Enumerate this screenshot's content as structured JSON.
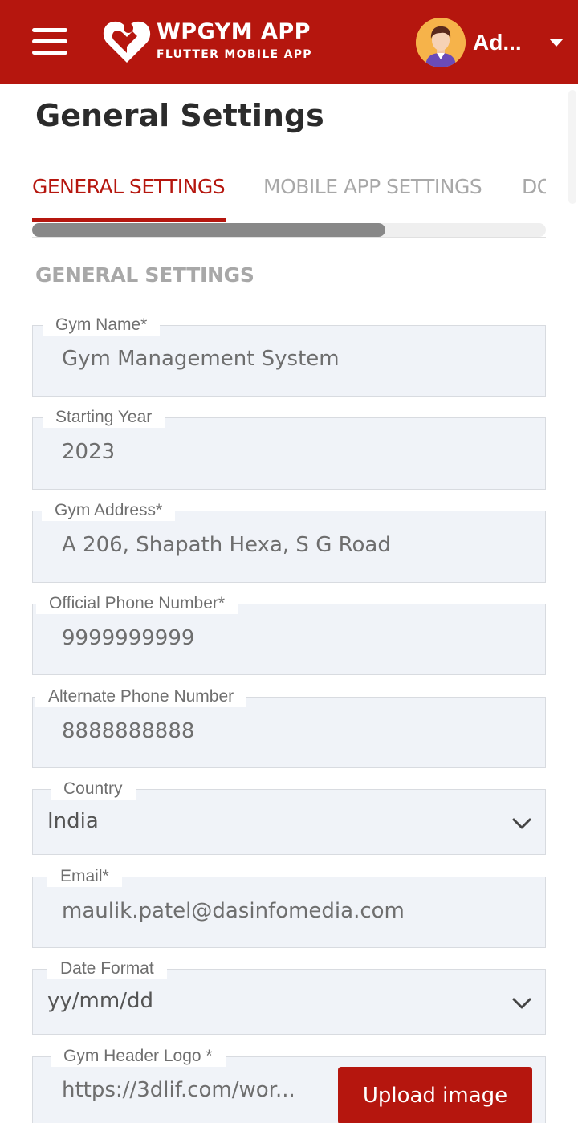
{
  "appbar": {
    "brand_title": "WPGYM APP",
    "brand_subtitle": "FLUTTER MOBILE APP",
    "user_name": "Ad...",
    "bg_color": "#b5160e",
    "menu_icon": "hamburger-icon",
    "dropdown_icon": "caret-down-icon"
  },
  "page": {
    "title": "General Settings"
  },
  "tabs": [
    {
      "label": "GENERAL SETTINGS",
      "active": true
    },
    {
      "label": "MOBILE APP SETTINGS",
      "active": false
    },
    {
      "label": "DOCUMENT SETTINGS",
      "active": false
    }
  ],
  "section": {
    "title": "GENERAL SETTINGS"
  },
  "fields": {
    "gym_name": {
      "label": "Gym Name*",
      "value": "Gym Management System"
    },
    "starting_year": {
      "label": "Starting Year",
      "value": "2023"
    },
    "gym_address": {
      "label": "Gym Address*",
      "value": "A 206, Shapath Hexa, S G Road"
    },
    "official_phone": {
      "label": "Official Phone Number*",
      "value": "9999999999"
    },
    "alternate_phone": {
      "label": "Alternate Phone Number",
      "value": "8888888888"
    },
    "country": {
      "label": "Country",
      "value": "India"
    },
    "email": {
      "label": "Email*",
      "value": "maulik.patel@dasinfomedia.com"
    },
    "date_format": {
      "label": "Date Format",
      "value": "yy/mm/dd"
    },
    "gym_header_logo": {
      "label": "Gym Header Logo *",
      "value": "https://3dlif.com/wor...",
      "button_label": "Upload image"
    }
  },
  "colors": {
    "accent": "#b5160e",
    "field_bg": "#f0f3f8",
    "muted_text": "#a8a8a8"
  }
}
